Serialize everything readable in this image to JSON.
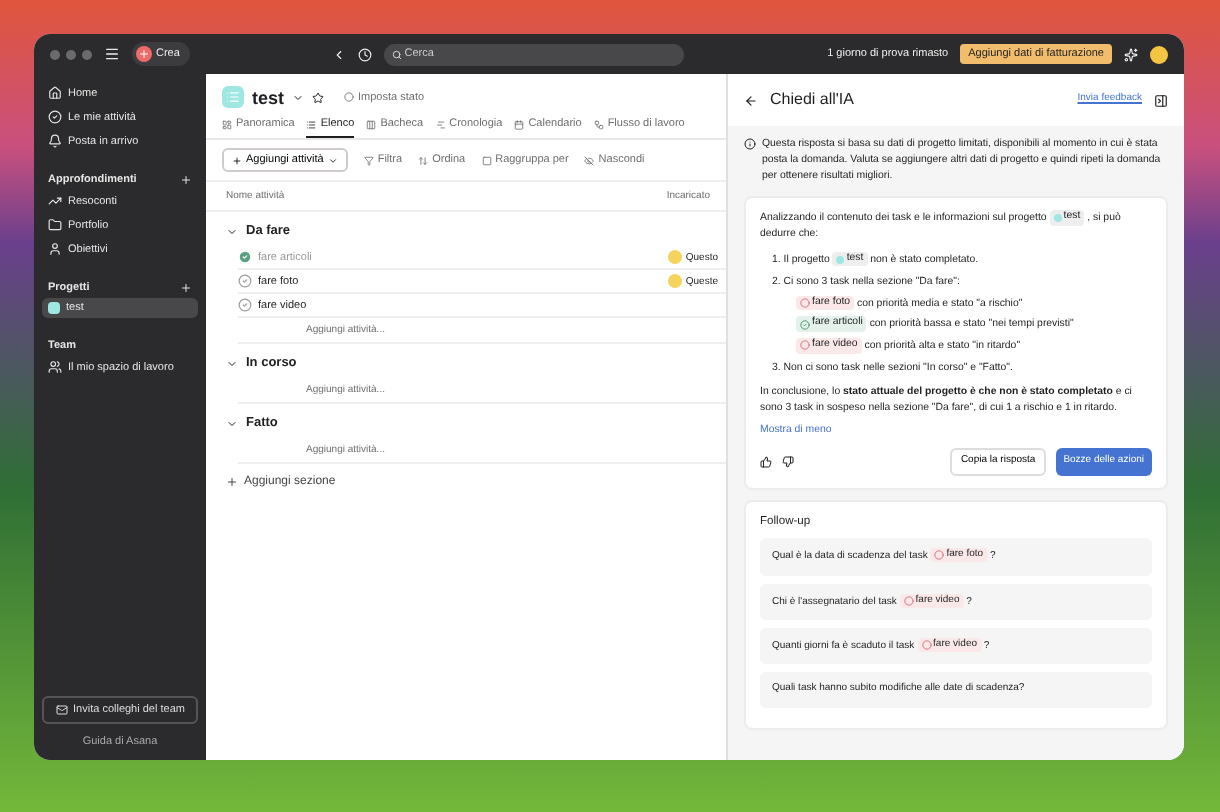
{
  "topbar": {
    "create_button": "Crea",
    "search": {
      "placeholder": "Cerca"
    },
    "trial_notice": "1 giorno di prova rimasto",
    "billing_button": "Aggiungi dati di fatturazione"
  },
  "sidebar": {
    "nav": [
      {
        "label": "Home"
      },
      {
        "label": "Le mie attività"
      },
      {
        "label": "Posta in arrivo"
      }
    ],
    "sections": [
      {
        "title": "Approfondimenti",
        "addable": true,
        "items": [
          {
            "label": "Resoconti",
            "selected": false
          },
          {
            "label": "Portfolio",
            "selected": false
          },
          {
            "label": "Obiettivi",
            "selected": false
          }
        ]
      },
      {
        "title": "Progetti",
        "addable": true,
        "items": [
          {
            "label": "test",
            "selected": true
          }
        ]
      },
      {
        "title": "Team",
        "addable": false,
        "items": [
          {
            "label": "Il mio spazio di lavoro",
            "selected": false
          }
        ]
      }
    ],
    "invite_button": "Invita colleghi del team",
    "help_link": "Guida di Asana"
  },
  "project": {
    "title": "test",
    "set_status": "Imposta stato",
    "tabs": [
      {
        "label": "Panoramica",
        "selected": false
      },
      {
        "label": "Elenco",
        "selected": true
      },
      {
        "label": "Bacheca",
        "selected": false
      },
      {
        "label": "Cronologia",
        "selected": false
      },
      {
        "label": "Calendario",
        "selected": false
      },
      {
        "label": "Flusso di lavoro",
        "selected": false
      }
    ],
    "toolbar": {
      "add_task": "Aggiungi attività",
      "filter": "Filtra",
      "sort": "Ordina",
      "group": "Raggruppa per",
      "hide": "Nascondi"
    },
    "columns": [
      "Nome attività",
      "Incaricato"
    ],
    "sections": [
      {
        "title": "Da fare",
        "tasks": [
          {
            "name": "fare articoli",
            "completed": true,
            "assignee": "Questo"
          },
          {
            "name": "fare foto",
            "completed": false,
            "assignee": "Queste"
          },
          {
            "name": "fare video",
            "completed": false
          }
        ],
        "add_task": "Aggiungi attività..."
      },
      {
        "title": "In corso",
        "add_task": "Aggiungi attività..."
      },
      {
        "title": "Fatto",
        "add_task": "Aggiungi attività..."
      }
    ],
    "add_section": "Aggiungi sezione"
  },
  "ai_panel": {
    "title": "Chiedi all'IA",
    "feedback_link": "Invia feedback",
    "notice": "Questa risposta si basa su dati di progetto limitati, disponibili al momento in cui è stata posta la domanda. Valuta se aggiungere altri dati di progetto e quindi ripeti la domanda per ottenere risultati migliori.",
    "answer": {
      "intro": {
        "before": "Analizzando il contenuto dei task e le informazioni sul progetto",
        "chip": {
          "label": "test",
          "kind": "project"
        },
        "after": ", si può dedurre che:"
      },
      "points": [
        {
          "number": "1.",
          "before": "Il progetto",
          "chip": {
            "label": "test",
            "kind": "project"
          },
          "after": "non è stato completato."
        },
        {
          "number": "2.",
          "before": "Ci sono 3 task nella sezione \"Da fare\":",
          "bullets": [
            {
              "chip": {
                "label": "fare foto",
                "kind": "task"
              },
              "after": "con priorità media e stato \"a rischio\""
            },
            {
              "chip": {
                "label": "fare articoli",
                "kind": "done"
              },
              "after": "con priorità bassa e stato \"nei tempi previsti\""
            },
            {
              "chip": {
                "label": "fare video",
                "kind": "task"
              },
              "after": "con priorità alta e stato \"in ritardo\""
            }
          ]
        },
        {
          "number": "3.",
          "before": "Non ci sono task nelle sezioni \"In corso\" e \"Fatto\"."
        }
      ],
      "conclusion": "In conclusione, lo **stato attuale del progetto è che non è stato completato** e ci sono 3 task in sospeso nella sezione \"Da fare\", di cui 1 a rischio e 1 in ritardo.",
      "show_less": "Mostra di meno",
      "copy_button": "Copia la risposta",
      "draft_button": "Bozze delle azioni"
    },
    "followup": {
      "title": "Follow-up",
      "questions": [
        {
          "before": "Qual è la data di scadenza del task",
          "chip": {
            "label": "fare foto",
            "kind": "task"
          },
          "after": "?"
        },
        {
          "before": "Chi è l'assegnatario del task",
          "chip": {
            "label": "fare video",
            "kind": "task"
          },
          "after": "?"
        },
        {
          "before": "Quanti giorni fa è scaduto il task",
          "chip": {
            "label": "fare video",
            "kind": "task"
          },
          "after": "?"
        },
        {
          "before": "Quali task hanno subito modifiche alle date di scadenza?"
        }
      ]
    }
  }
}
